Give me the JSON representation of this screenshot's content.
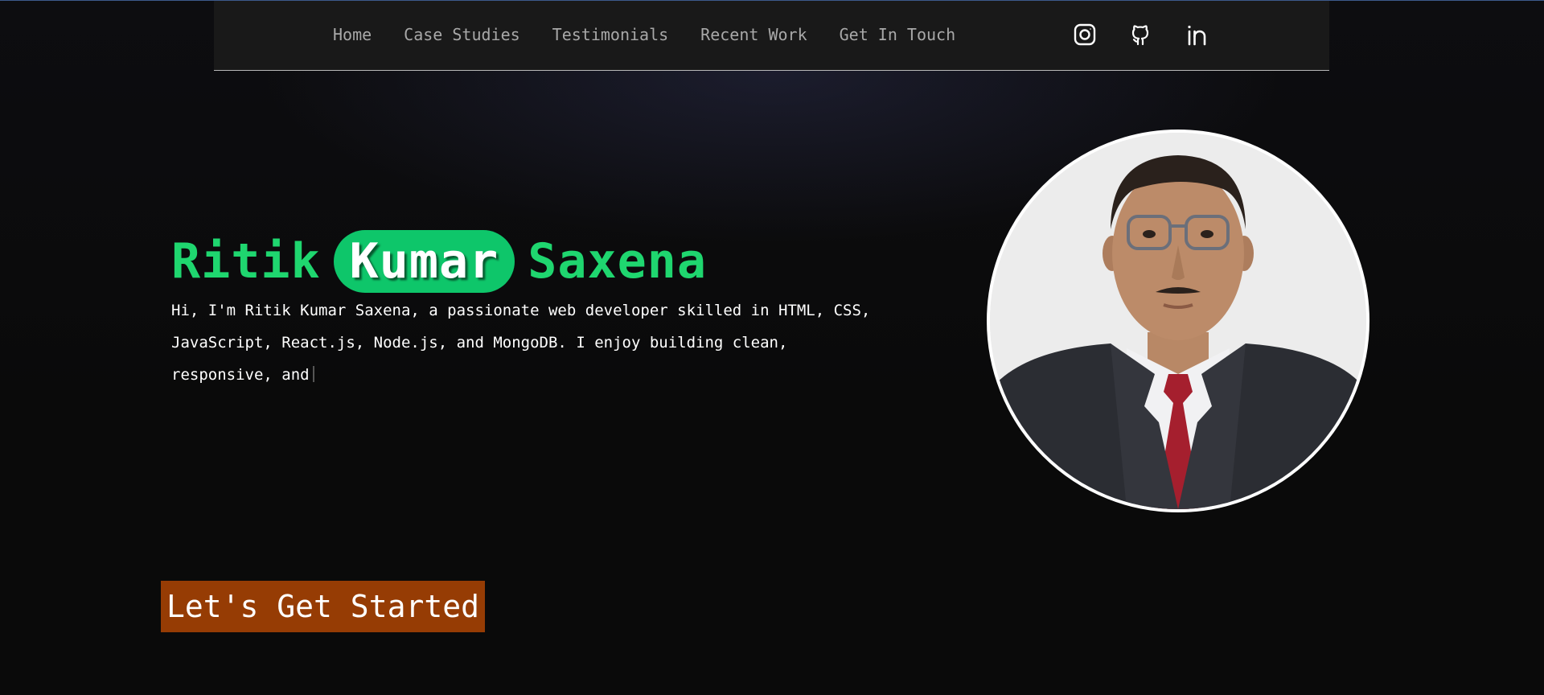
{
  "nav": {
    "links": [
      {
        "label": "Home"
      },
      {
        "label": "Case Studies"
      },
      {
        "label": "Testimonials"
      },
      {
        "label": "Recent Work"
      },
      {
        "label": "Get In Touch"
      }
    ],
    "socials": [
      {
        "icon": "instagram-icon"
      },
      {
        "icon": "github-icon"
      },
      {
        "icon": "linkedin-icon"
      }
    ]
  },
  "hero": {
    "name_first": "Ritik",
    "name_middle": "Kumar",
    "name_last": "Saxena",
    "description": "Hi, I'm Ritik Kumar Saxena, a passionate web developer skilled in HTML, CSS, JavaScript, React.js, Node.js, and MongoDB. I enjoy building clean, responsive, and",
    "cta_label": "Let's Get Started"
  },
  "colors": {
    "accent_green": "#1fd66f",
    "pill_green": "#0ec66a",
    "cta_orange": "#963c04",
    "nav_bg": "#191919"
  }
}
